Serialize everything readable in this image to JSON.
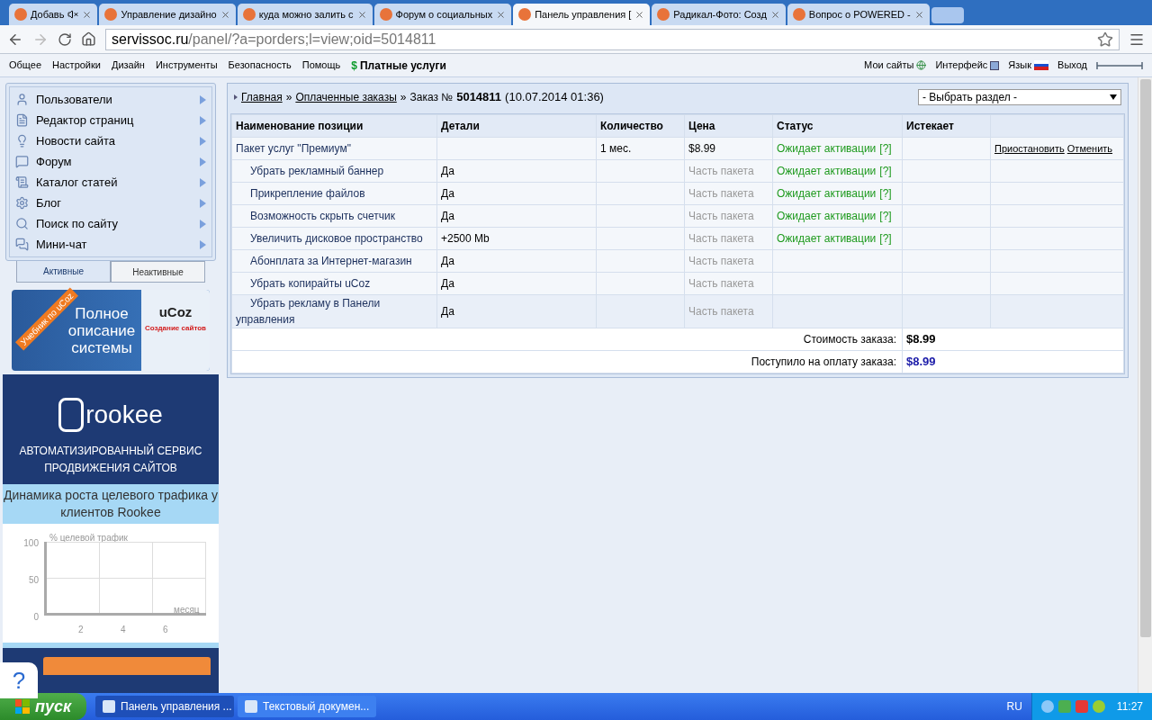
{
  "browser": {
    "tabs": [
      {
        "label": "Добавь",
        "selected": false,
        "muted": true
      },
      {
        "label": "Управление дизайно",
        "selected": false,
        "muted": false
      },
      {
        "label": "куда можно залить с",
        "selected": false,
        "muted": false
      },
      {
        "label": "Форум о социальных",
        "selected": false,
        "muted": false
      },
      {
        "label": "Панель управления [",
        "selected": true,
        "muted": false
      },
      {
        "label": "Радикал-Фото: Созд",
        "selected": false,
        "muted": false
      },
      {
        "label": "Вопрос о POWERED -",
        "selected": false,
        "muted": false
      }
    ],
    "url_host": "servissoc.ru",
    "url_path": "/panel/?a=porders;l=view;oid=5014811"
  },
  "topmenu": {
    "left": [
      "Общее",
      "Настройки",
      "Дизайн",
      "Инструменты",
      "Безопасность",
      "Помощь"
    ],
    "paid_icon": "$",
    "paid": "Платные услуги",
    "right": [
      "Мои сайты",
      "Интерфейс",
      "Язык",
      "Выход"
    ]
  },
  "sidebar": {
    "items": [
      "Пользователи",
      "Редактор страниц",
      "Новости сайта",
      "Форум",
      "Каталог статей",
      "Блог",
      "Поиск по сайту",
      "Мини-чат"
    ],
    "tabs": [
      {
        "label": "Активные",
        "selected": true
      },
      {
        "label": "Неактивные",
        "selected": false
      }
    ]
  },
  "ucoz_ad": {
    "ribbon": "Учебник по uCoz",
    "headline": "Полное описание системы",
    "book_title": "uCoz",
    "book_subtitle": "Создание сайтов"
  },
  "rookee_ad": {
    "logo": "rookee",
    "tagline": "АВТОМАТИЗИРОВАННЫЙ СЕРВИС ПРОДВИЖЕНИЯ САЙТОВ",
    "subtitle": "Динамика роста целевого трафика у клиентов Rookee",
    "ylabel": "% целевой трафик",
    "xlabel": "месяц",
    "yticks": [
      "100",
      "50",
      "0"
    ],
    "xticks": [
      "2",
      "4",
      "6"
    ]
  },
  "help_button": "?",
  "breadcrumb": {
    "links": [
      "Главная",
      "Оплаченные заказы"
    ],
    "separator": "»",
    "label": "Заказ №",
    "number": "5014811",
    "date": "(10.07.2014 01:36)"
  },
  "section_select": {
    "value": "- Выбрать раздел -"
  },
  "table": {
    "columns": [
      "Наименование позиции",
      "Детали",
      "Количество",
      "Цена",
      "Статус",
      "Истекает"
    ],
    "rows": [
      {
        "kind": "package",
        "name": "Пакет услуг \"Премиум\"",
        "details": "",
        "quantity": "1 мес.",
        "price": "$8.99",
        "status": "Ожидает активации",
        "status_help": "[?]",
        "actions": [
          "Приостановить",
          "Отменить"
        ]
      },
      {
        "kind": "item",
        "name": "Убрать рекламный баннер",
        "details": "Да",
        "quantity": "",
        "price": "Часть пакета",
        "status": "Ожидает активации",
        "status_help": "[?]",
        "actions": []
      },
      {
        "kind": "item",
        "name": "Прикрепление файлов",
        "details": "Да",
        "quantity": "",
        "price": "Часть пакета",
        "status": "Ожидает активации",
        "status_help": "[?]",
        "actions": []
      },
      {
        "kind": "item",
        "name": "Возможность скрыть счетчик",
        "details": "Да",
        "quantity": "",
        "price": "Часть пакета",
        "status": "Ожидает активации",
        "status_help": "[?]",
        "actions": []
      },
      {
        "kind": "item",
        "name": "Увеличить дисковое пространство",
        "details": "+2500 Mb",
        "quantity": "",
        "price": "Часть пакета",
        "status": "Ожидает активации",
        "status_help": "[?]",
        "actions": []
      },
      {
        "kind": "item",
        "name": "Абонплата за Интернет-магазин",
        "details": "Да",
        "quantity": "",
        "price": "Часть пакета",
        "status": "",
        "status_help": "",
        "actions": []
      },
      {
        "kind": "item",
        "name": "Убрать копирайты uCoz",
        "details": "Да",
        "quantity": "",
        "price": "Часть пакета",
        "status": "",
        "status_help": "",
        "actions": []
      },
      {
        "kind": "item",
        "name": "Убрать рекламу в Панели управления",
        "details": "Да",
        "quantity": "",
        "price": "Часть пакета",
        "status": "",
        "status_help": "",
        "actions": []
      }
    ],
    "totals": [
      {
        "label": "Стоимость заказа:",
        "value": "$8.99",
        "kind": "cost"
      },
      {
        "label": "Поступило на оплату заказа:",
        "value": "$8.99",
        "kind": "paid"
      }
    ]
  },
  "taskbar": {
    "start": "пуск",
    "tasks": [
      {
        "label": "Панель управления ...",
        "selected": true
      },
      {
        "label": "Текстовый докумен...",
        "selected": false
      }
    ],
    "lang": "RU",
    "time": "11:27"
  }
}
